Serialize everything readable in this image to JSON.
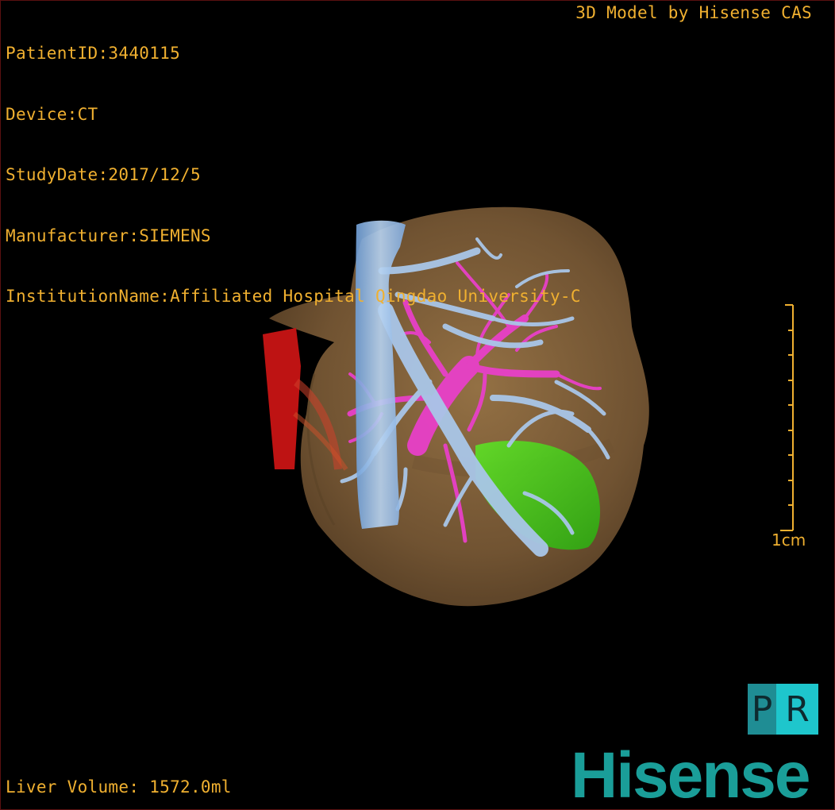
{
  "patient_info": {
    "patient_id": "PatientID:3440115",
    "device": "Device:CT",
    "study_date": "StudyDate:2017/12/5",
    "manufacturer": "Manufacturer:SIEMENS",
    "institution": "InstitutionName:Affiliated Hospital Qingdao University-C"
  },
  "model_credit": "3D Model by Hisense CAS",
  "volume_readout": "Liver Volume: 1572.0ml",
  "scale_bar": {
    "label": "1cm",
    "tick_count": 10
  },
  "pr_button": {
    "left_letter": "P",
    "right_letter": "R"
  },
  "brand": {
    "name": "Hisense",
    "color": "#1a9e99"
  },
  "overlay_text_color": "#f0b030",
  "render_colors": {
    "liver": "#8a6a42",
    "hepatic_vein": "#a9c6e8",
    "portal_vein": "#e840c8",
    "gallbladder": "#4ccf1c",
    "aorta": "#c81414",
    "ivc": "#7fb0e6"
  }
}
